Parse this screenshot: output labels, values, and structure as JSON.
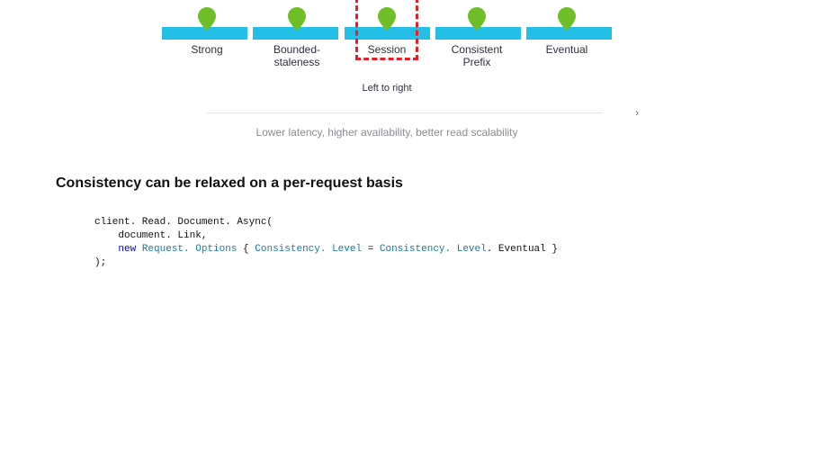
{
  "scale": {
    "labels": [
      "Strong",
      "Bounded-\nstaleness",
      "Session",
      "Consistent\nPrefix",
      "Eventual"
    ],
    "positions_pct": [
      10,
      30,
      50,
      70,
      90
    ],
    "selected_index": 2,
    "axis_caption": "Left to right",
    "arrow_hint": "›",
    "sub_caption": "Lower latency, higher availability, better read scalability",
    "pin_color": "#6fbe28",
    "track_color": "#24bfe6",
    "highlight_color": "#e71e26"
  },
  "heading": "Consistency can be relaxed on a per-request basis",
  "code": {
    "line1_a": "client",
    "line1_b": ". Read. Document. Async(",
    "line2": "    document. Link,",
    "line3_kw": "new",
    "line3_ty1": "Request. Options",
    "line3_mid": " { ",
    "line3_ty2": "Consistency. Level",
    "line3_eq": " = ",
    "line3_ty3": "Consistency. Level",
    "line3_end": ". Eventual }",
    "line4": ");"
  }
}
